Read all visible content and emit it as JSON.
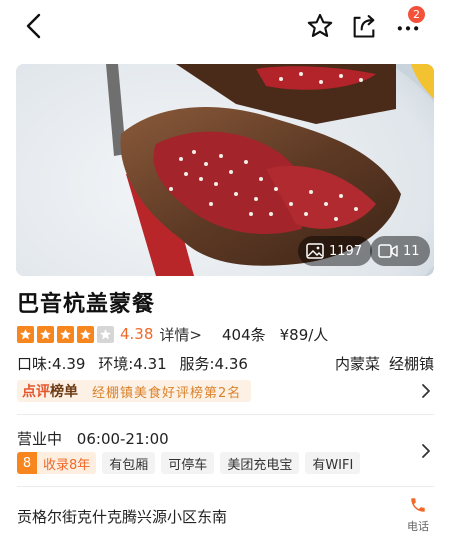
{
  "header": {
    "back_icon": "chevron-left-icon",
    "favorite_icon": "star-outline-icon",
    "share_icon": "share-icon",
    "more_icon": "more-dots-icon",
    "notification_count": "2"
  },
  "gallery": {
    "photo_count": "1197",
    "video_count": "11"
  },
  "shop": {
    "name": "巴音杭盖蒙餐",
    "rating_stars": 4,
    "rating_max": 5,
    "score": "4.38",
    "detail_label": "详情>",
    "review_count": "404条",
    "price_per_person": "¥89/人",
    "taste": "口味:4.39",
    "environment": "环境:4.31",
    "service": "服务:4.36",
    "category": "内蒙菜",
    "area": "经棚镇"
  },
  "ranking": {
    "tag_part1": "点评",
    "tag_part2": "榜单",
    "text": "经棚镇美食好评榜第2名"
  },
  "info": {
    "status": "营业中",
    "hours": "06:00-21:00",
    "years_number": "8",
    "years_label": "收录8年",
    "tags": [
      "有包厢",
      "可停车",
      "美团充电宝",
      "有WIFI"
    ]
  },
  "location": {
    "address": "贡格尔街克什克腾兴源小区东南",
    "phone_label": "电话"
  },
  "colors": {
    "accent": "#f06a2a",
    "star_on": "#f7861f",
    "badge": "#f4513a"
  }
}
